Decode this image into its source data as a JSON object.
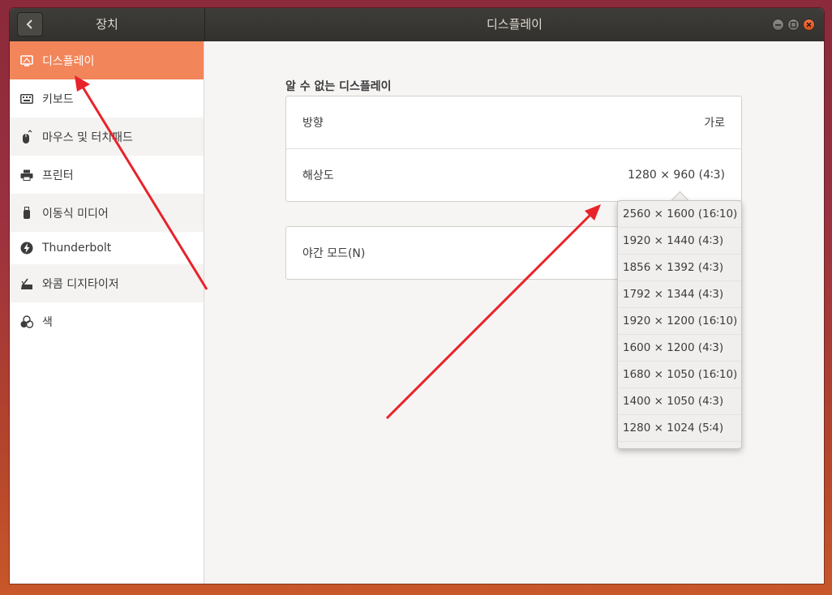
{
  "window": {
    "sidebar_title": "장치",
    "main_title": "디스플레이"
  },
  "sidebar": {
    "items": [
      {
        "label": "디스플레이",
        "icon": "display-icon"
      },
      {
        "label": "키보드",
        "icon": "keyboard-icon"
      },
      {
        "label": "마우스 및 터치패드",
        "icon": "mouse-icon"
      },
      {
        "label": "프린터",
        "icon": "printer-icon"
      },
      {
        "label": "이동식 미디어",
        "icon": "usb-icon"
      },
      {
        "label": "Thunderbolt",
        "icon": "thunderbolt-icon"
      },
      {
        "label": "와콤 디지타이저",
        "icon": "tablet-icon"
      },
      {
        "label": "색",
        "icon": "color-icon"
      }
    ]
  },
  "display": {
    "section_title": "알 수 없는 디스플레이",
    "orientation_label": "방향",
    "orientation_value": "가로",
    "resolution_label": "해상도",
    "resolution_value": "1280 × 960 (4∶3)",
    "night_mode_label": "야간 모드(N)"
  },
  "resolution_options": [
    "2560 × 1600 (16∶10)",
    "1920 × 1440 (4∶3)",
    "1856 × 1392 (4∶3)",
    "1792 × 1344 (4∶3)",
    "1920 × 1200 (16∶10)",
    "1600 × 1200 (4∶3)",
    "1680 × 1050 (16∶10)",
    "1400 × 1050 (4∶3)",
    "1280 × 1024 (5∶4)"
  ],
  "colors": {
    "accent": "#f3855a",
    "annotation_arrow": "#e8232a",
    "titlebar": "#3a3834"
  }
}
